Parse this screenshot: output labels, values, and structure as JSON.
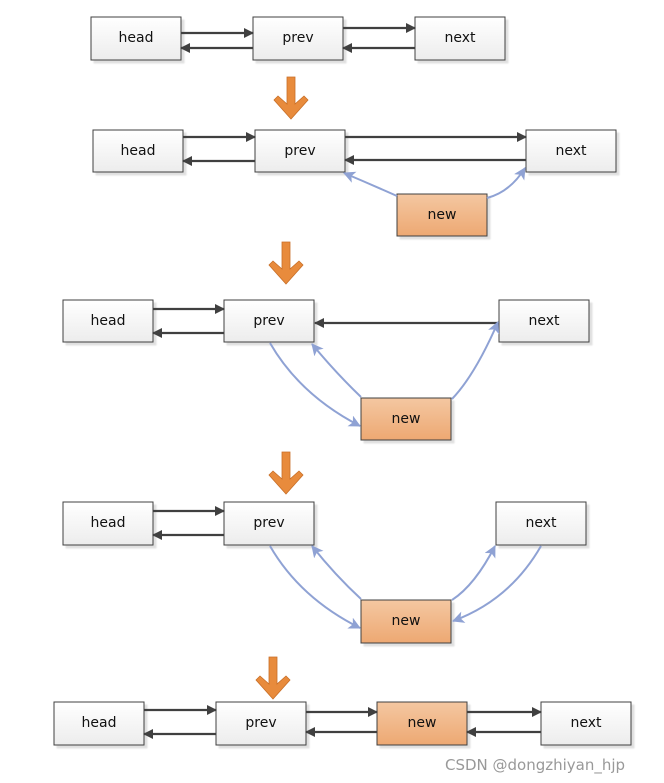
{
  "labels": {
    "head": "head",
    "prev": "prev",
    "next": "next",
    "new": "new"
  },
  "watermark": "CSDN @dongzhiyan_hjp",
  "colors": {
    "node_border": "#404040",
    "new_node_fill": "#f0b483",
    "step_arrow": "#e88b3c",
    "new_link": "#8fa2d4",
    "link": "#404040"
  }
}
